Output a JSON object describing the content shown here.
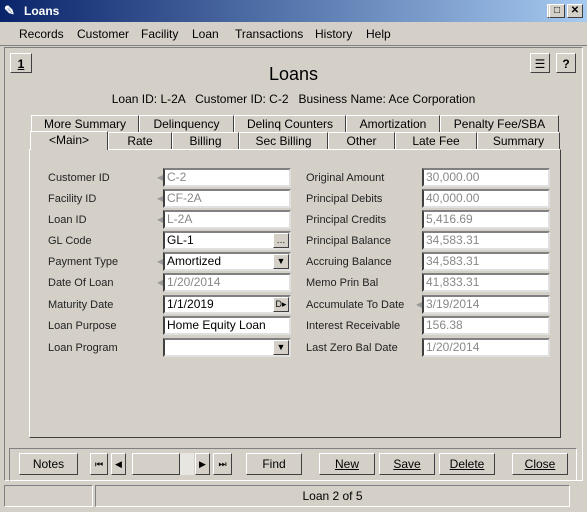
{
  "window": {
    "title": "Loans"
  },
  "menu": [
    "Records",
    "Customer",
    "Facility",
    "Loan",
    "Transactions",
    "History",
    "Help"
  ],
  "header": {
    "title": "Loans",
    "subtitle": "Loan ID: L-2A   Customer ID: C-2   Business Name: Ace Corporation",
    "record_button": "1",
    "help_button": "?"
  },
  "tabs_row1": [
    "More Summary",
    "Delinquency",
    "Delinq Counters",
    "Amortization",
    "Penalty Fee/SBA"
  ],
  "tabs_row2": [
    "<Main>",
    "Rate",
    "Billing",
    "Sec Billing",
    "Other",
    "Late Fee",
    "Summary"
  ],
  "active_tab": "<Main>",
  "left_fields": [
    {
      "label": "Customer ID",
      "value": "C-2",
      "readonly": true,
      "marker": true
    },
    {
      "label": "Facility ID",
      "value": "CF-2A",
      "readonly": true,
      "marker": true
    },
    {
      "label": "Loan ID",
      "value": "L-2A",
      "readonly": true,
      "marker": true
    },
    {
      "label": "GL Code",
      "value": "GL-1",
      "button": "ellipsis"
    },
    {
      "label": "Payment Type",
      "value": "Amortized",
      "button": "dropdown",
      "marker": true
    },
    {
      "label": "Date Of Loan",
      "value": "1/20/2014",
      "readonly": true,
      "marker": true
    },
    {
      "label": "Maturity Date",
      "value": "1/1/2019",
      "button": "date"
    },
    {
      "label": "Loan Purpose",
      "value": "Home Equity Loan"
    },
    {
      "label": "Loan Program",
      "value": "",
      "button": "dropdown"
    }
  ],
  "right_fields": [
    {
      "label": "Original Amount",
      "value": "30,000.00",
      "readonly": true
    },
    {
      "label": "Principal Debits",
      "value": "40,000.00",
      "readonly": true
    },
    {
      "label": "Principal Credits",
      "value": "5,416.69",
      "readonly": true
    },
    {
      "label": "Principal Balance",
      "value": "34,583.31",
      "readonly": true
    },
    {
      "label": "Accruing Balance",
      "value": "34,583.31",
      "readonly": true
    },
    {
      "label": "Memo Prin Bal",
      "value": "41,833.31",
      "readonly": true
    },
    {
      "label": "Accumulate To Date",
      "value": "3/19/2014",
      "readonly": true,
      "marker": true
    },
    {
      "label": "Interest Receivable",
      "value": "156.38",
      "readonly": true
    },
    {
      "label": "Last Zero Bal Date",
      "value": "1/20/2014",
      "readonly": true
    }
  ],
  "toolbar": {
    "notes": "Notes",
    "find": "Find",
    "new": "New",
    "save": "Save",
    "delete": "Delete",
    "close": "Close"
  },
  "status": {
    "record": "Loan 2 of 5"
  }
}
